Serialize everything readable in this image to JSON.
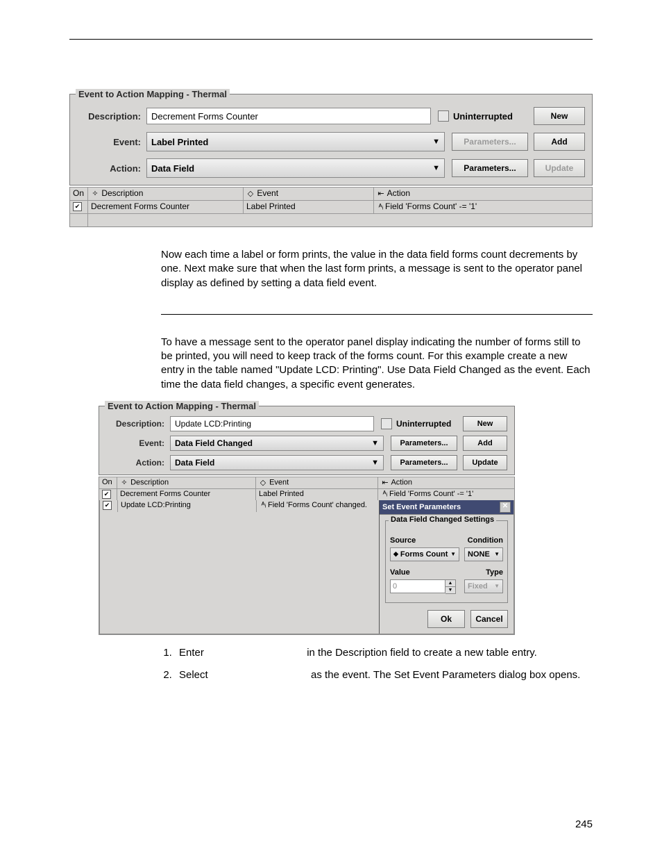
{
  "page_number": "245",
  "panel1": {
    "title": "Event to Action Mapping - Thermal",
    "labels": {
      "description": "Description:",
      "event": "Event:",
      "action": "Action:"
    },
    "description_value": "Decrement Forms Counter",
    "uninterrupted_label": "Uninterrupted",
    "event_value": "Label Printed",
    "action_value": "Data Field",
    "buttons": {
      "new": "New",
      "add": "Add",
      "update": "Update",
      "params": "Parameters..."
    },
    "headers": {
      "on": "On",
      "description": "Description",
      "event": "Event",
      "action": "Action"
    },
    "rows": [
      {
        "on": "✔",
        "description": "Decrement Forms Counter",
        "event": "Label Printed",
        "action": "Field 'Forms Count' -= '1'"
      }
    ]
  },
  "para1": "Now each time a label or form prints, the value in the data field forms count decrements by one. Next make sure that when the last form prints, a message is sent to the operator panel display as defined by setting a data field event.",
  "para2": "To have a message sent to the operator panel display indicating the number of forms still to be printed, you will need to keep track of the forms count. For this example create a new entry in the table named \"Update LCD: Printing\". Use Data Field Changed as the event. Each time the data field changes, a specific event generates.",
  "panel2": {
    "title": "Event to Action Mapping - Thermal",
    "labels": {
      "description": "Description:",
      "event": "Event:",
      "action": "Action:"
    },
    "description_value": "Update LCD:Printing",
    "uninterrupted_label": "Uninterrupted",
    "event_value": "Data Field Changed",
    "action_value": "Data Field",
    "buttons": {
      "new": "New",
      "add": "Add",
      "update": "Update",
      "params": "Parameters..."
    },
    "headers": {
      "on": "On",
      "description": "Description",
      "event": "Event",
      "action": "Action"
    },
    "rows": [
      {
        "on": "✔",
        "description": "Decrement Forms Counter",
        "event": "Label Printed",
        "action": "Field 'Forms Count' -= '1'"
      },
      {
        "on": "✔",
        "description": "Update LCD:Printing",
        "event": "Field 'Forms Count' changed.",
        "action": ""
      }
    ]
  },
  "popup": {
    "title": "Set Event Parameters",
    "group_title": "Data Field Changed Settings",
    "source_label": "Source",
    "source_value": "Forms Count",
    "condition_label": "Condition",
    "condition_value": "NONE",
    "value_label": "Value",
    "value_value": "0",
    "type_label": "Type",
    "type_value": "Fixed",
    "ok": "Ok",
    "cancel": "Cancel"
  },
  "steps": [
    {
      "prefix": "Enter",
      "suffix": "in the Description field to create a new table entry."
    },
    {
      "prefix": "Select",
      "suffix": "as the event. The Set Event Parameters dialog box opens."
    }
  ]
}
